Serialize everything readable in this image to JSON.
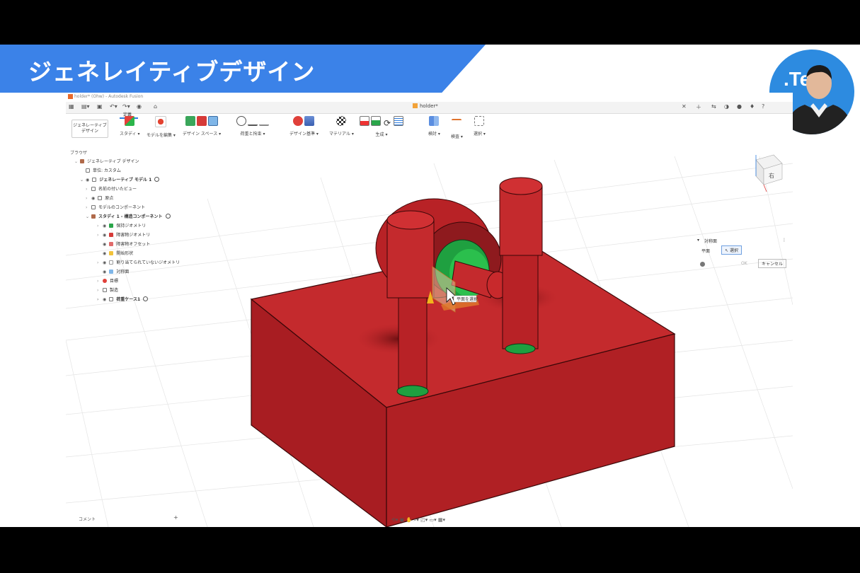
{
  "slide_title": "ジェネレイティブデザイン",
  "presenter_logo": ".Te",
  "window_title": "holder* (Ohw) - Autodesk Fusion",
  "doc_tab": "holder*",
  "toolbar": {
    "active_tab": "定義",
    "workspace": "ジェネレーティブ\nデザイン",
    "groups": [
      {
        "label": "スタディ ▾"
      },
      {
        "label": "モデルを編集 ▾"
      },
      {
        "label": "デザイン スペース ▾"
      },
      {
        "label": "荷重と拘束 ▾"
      },
      {
        "label": "デザイン基準 ▾"
      },
      {
        "label": "マテリアル ▾"
      },
      {
        "label": "生成 ▾"
      },
      {
        "label": "検討 ▾"
      },
      {
        "label": "検査 ▾"
      },
      {
        "label": "選択 ▾"
      }
    ]
  },
  "browser": {
    "header": "ブラウザ",
    "rows": [
      {
        "label": "ジェネレーティブ デザイン"
      },
      {
        "label": "単位: カスタム"
      },
      {
        "label": "ジェネレーティブ モデル 1"
      },
      {
        "label": "名前の付いたビュー"
      },
      {
        "label": "原点"
      },
      {
        "label": "モデルのコンポーネント"
      },
      {
        "label": "スタディ 1 - 構造コンポーネント"
      },
      {
        "label": "保持ジオメトリ"
      },
      {
        "label": "障害物ジオメトリ"
      },
      {
        "label": "障害物オフセット"
      },
      {
        "label": "開始形状"
      },
      {
        "label": "割り当てられていないジオメトリ"
      },
      {
        "label": "対称面"
      },
      {
        "label": "目標"
      },
      {
        "label": "製造"
      },
      {
        "label": "荷重ケース1"
      }
    ]
  },
  "comment_label": "コメント",
  "symmetry_panel": {
    "title": "対称面",
    "field_label": "平面",
    "select_label": "選択",
    "ok": "OK",
    "cancel": "キャンセル"
  },
  "tooltip": "平面を選択",
  "viewcube_label": "右",
  "colors": {
    "banner": "#3b82e8",
    "obstacle_red": "#c2262a",
    "preserve_green": "#1fa040"
  }
}
